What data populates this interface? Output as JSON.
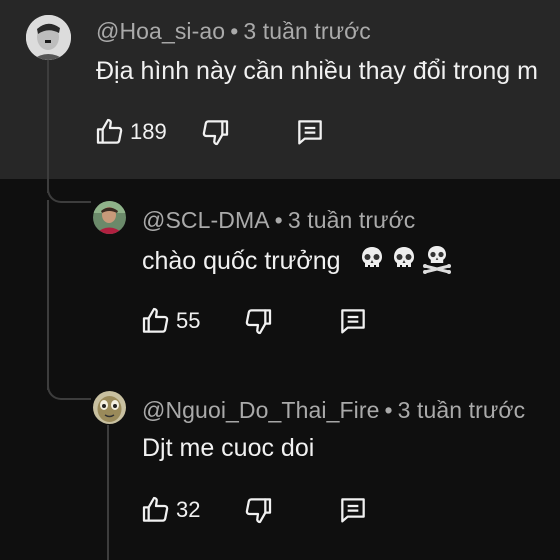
{
  "comments": [
    {
      "handle": "@Hoa_si-ao",
      "time": "3 tuần trước",
      "text": "Địa hình này cần nhiều thay đổi trong m",
      "likes": "189",
      "icons": [
        "thumbs-up-icon",
        "thumbs-down-icon",
        "reply-icon"
      ]
    },
    {
      "handle": "@SCL-DMA",
      "time": "3 tuần trước",
      "text": "chào quốc trưởng",
      "emojis": [
        "skull-emoji",
        "skull-emoji",
        "skull-crossbones-emoji"
      ],
      "likes": "55",
      "icons": [
        "thumbs-up-icon",
        "thumbs-down-icon",
        "reply-icon"
      ]
    },
    {
      "handle": "@Nguoi_Do_Thai_Fire",
      "time": "3 tuần trước",
      "text": "Djt me cuoc doi",
      "likes": "32",
      "icons": [
        "thumbs-up-icon",
        "thumbs-down-icon",
        "reply-icon"
      ]
    }
  ],
  "separator": "•",
  "colors": {
    "top_band": "#272727",
    "background": "#0f0f0f",
    "meta_text": "#aaaaaa",
    "body_text": "#f1f1f1",
    "thread_line": "#3d3d3d"
  }
}
